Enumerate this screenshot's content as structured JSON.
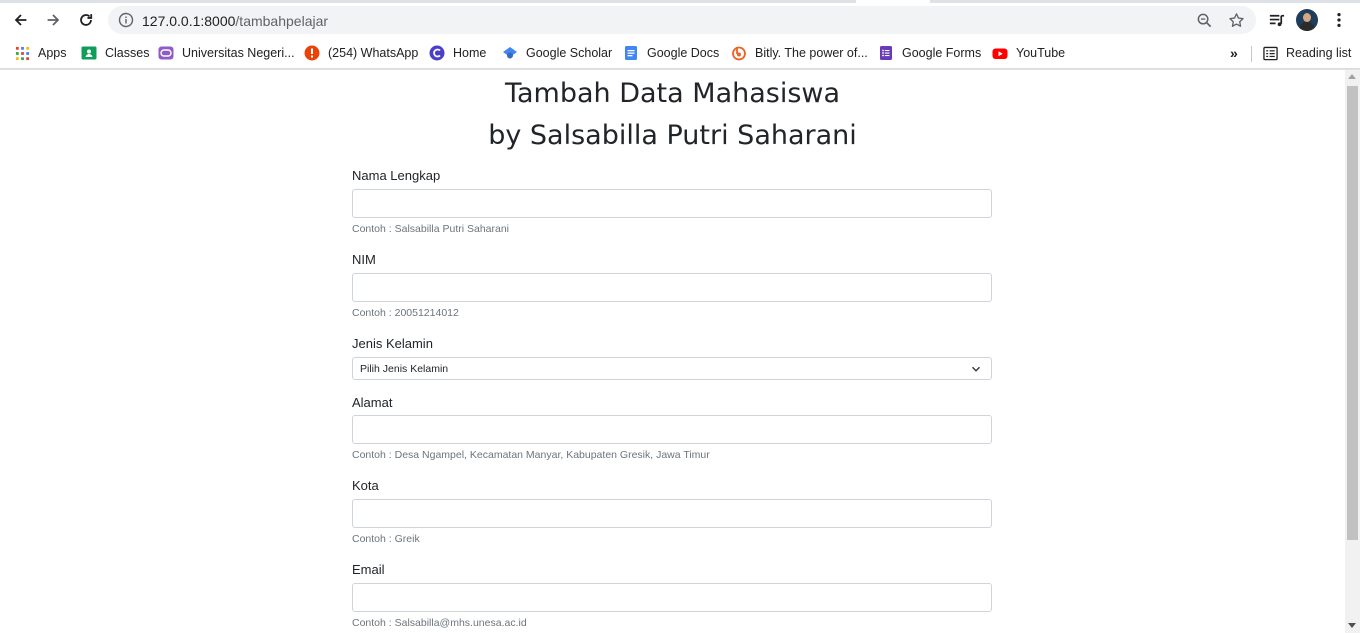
{
  "browser": {
    "url_host": "127.0.0.1:8000",
    "url_path": "/tambahpelajar",
    "bookmarks": [
      {
        "label": "Apps",
        "icon": "apps-grid-icon"
      },
      {
        "label": "Classes",
        "icon": "google-classroom-icon"
      },
      {
        "label": "Universitas Negeri...",
        "icon": "university-icon"
      },
      {
        "label": "(254) WhatsApp",
        "icon": "whatsapp-icon"
      },
      {
        "label": "Home",
        "icon": "home-site-icon"
      },
      {
        "label": "Google Scholar",
        "icon": "google-scholar-icon"
      },
      {
        "label": "Google Docs",
        "icon": "google-docs-icon"
      },
      {
        "label": "Bitly. The power of...",
        "icon": "bitly-icon"
      },
      {
        "label": "Google Forms",
        "icon": "google-forms-icon"
      },
      {
        "label": "YouTube",
        "icon": "youtube-icon"
      }
    ],
    "overflow_label": "»",
    "reading_list_label": "Reading list"
  },
  "page": {
    "title_line1": "Tambah Data Mahasiswa",
    "title_line2": "by Salsabilla Putri Saharani"
  },
  "form": {
    "nama": {
      "label": "Nama Lengkap",
      "value": "",
      "help": "Contoh : Salsabilla Putri Saharani"
    },
    "nim": {
      "label": "NIM",
      "value": "",
      "help": "Contoh : 20051214012"
    },
    "jenis_kelamin": {
      "label": "Jenis Kelamin",
      "selected": "Pilih Jenis Kelamin"
    },
    "alamat": {
      "label": "Alamat",
      "value": "",
      "help": "Contoh : Desa Ngampel, Kecamatan Manyar, Kabupaten Gresik, Jawa Timur"
    },
    "kota": {
      "label": "Kota",
      "value": "",
      "help": "Contoh : Greik"
    },
    "email": {
      "label": "Email",
      "value": "",
      "help": "Contoh : Salsabilla@mhs.unesa.ac.id"
    }
  },
  "colors": {
    "chrome_bg": "#dee1e6",
    "omnibox_bg": "#f1f3f4",
    "text_primary": "#212529",
    "text_muted": "#6c757d",
    "input_border": "#ced4da"
  }
}
